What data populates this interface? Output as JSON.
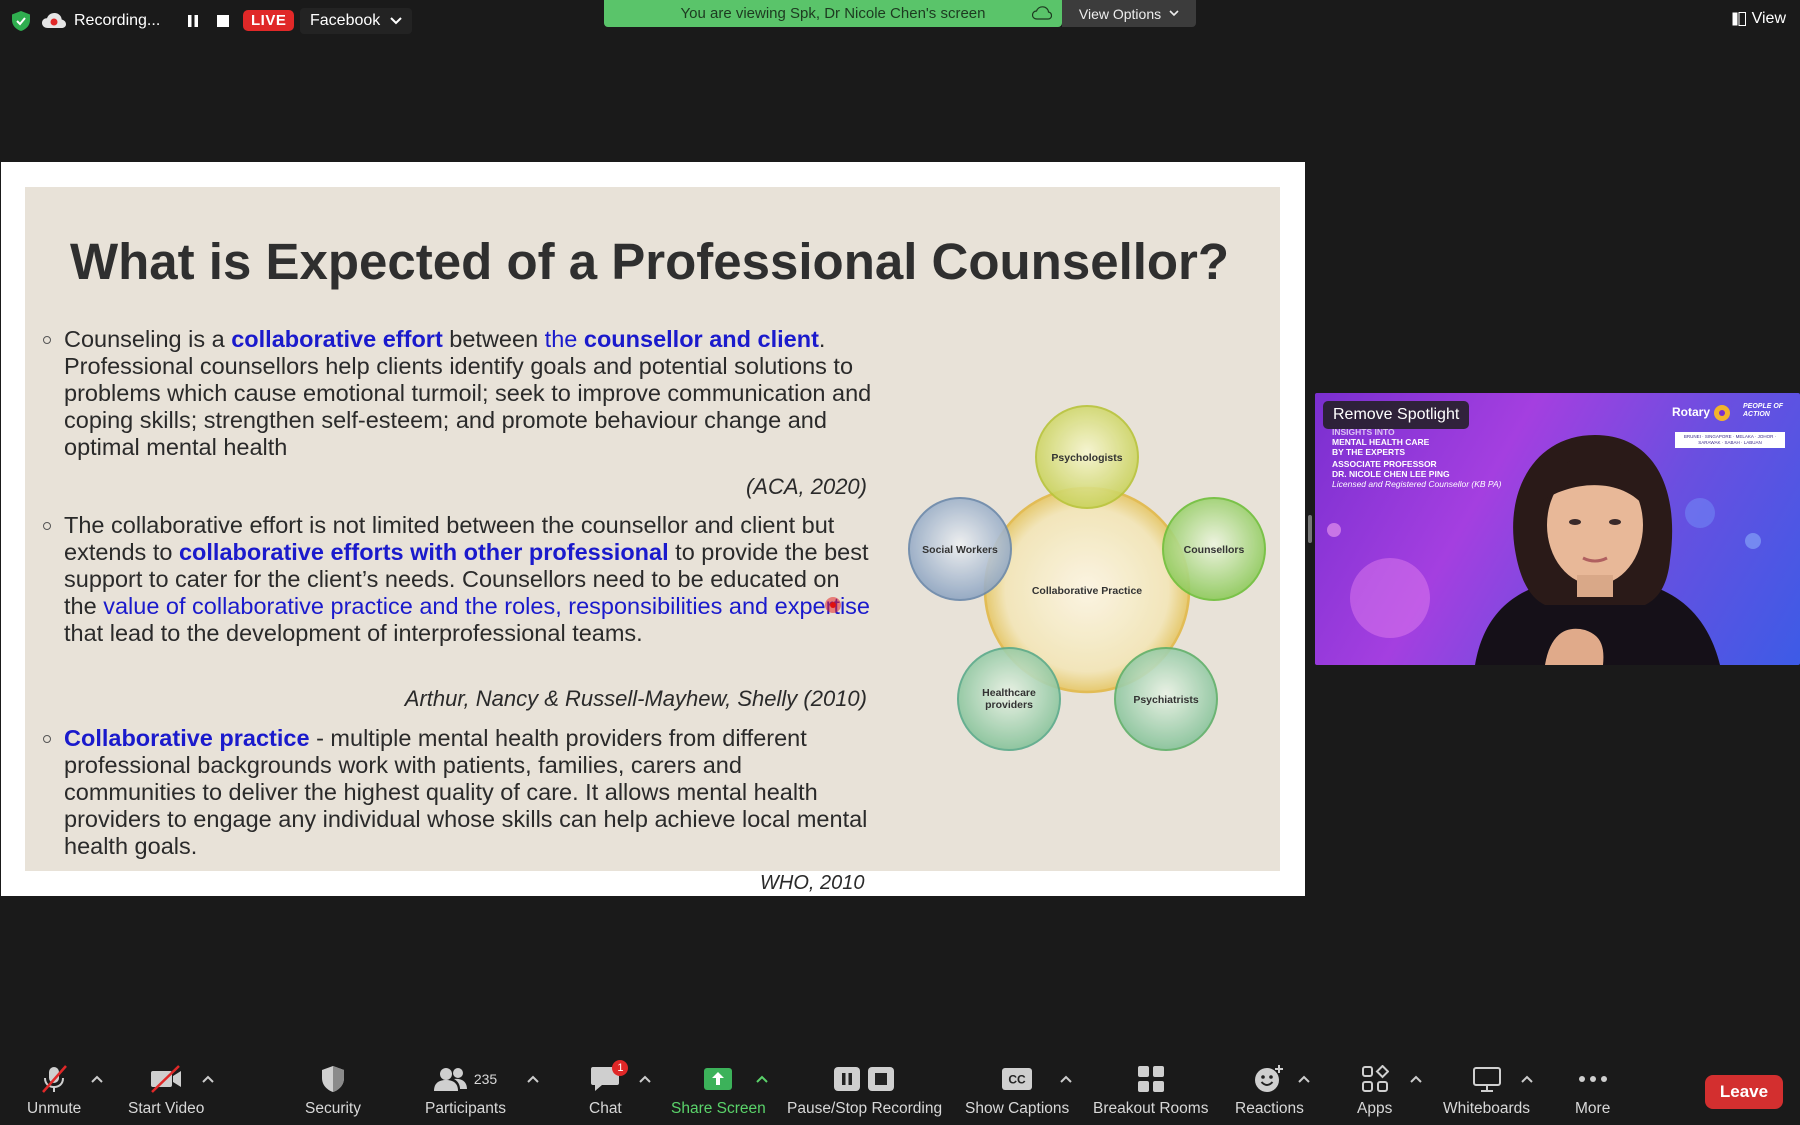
{
  "topbar": {
    "recording_label": "Recording...",
    "live_label": "LIVE",
    "stream_target": "Facebook",
    "viewing_banner": "You are viewing Spk, Dr Nicole Chen's screen",
    "view_options_label": "View Options",
    "view_label": "View"
  },
  "slide": {
    "title": "What is Expected of a Professional Counsellor?",
    "bullet1": {
      "t1": "Counseling is a ",
      "h1": "collaborative effort",
      "t2": " between ",
      "h2a": "the ",
      "h2b": "counsellor and client",
      "t3": ". Professional counsellors help clients identify goals and potential solutions to problems which cause emotional turmoil; seek to improve communication and coping skills; strengthen self-esteem; and promote behaviour change and optimal mental health"
    },
    "cite1": "(ACA, 2020)",
    "bullet2": {
      "t1": "The collaborative effort is not limited between the counsellor and client but extends to ",
      "h1": "collaborative efforts with other professional",
      "t2": " to provide the best support to cater for the client’s needs. Counsellors need to be educated on the ",
      "h2": "value of collaborative practice and the roles, responsibilities and expertise",
      "t3": " that lead to the development of interprofessional teams."
    },
    "cite2": "Arthur, Nancy & Russell-Mayhew, Shelly (2010)",
    "bullet3": {
      "h1": "Collaborative practice",
      "t1": "  - multiple mental health providers from different professional backgrounds work with patients, families, carers and communities to deliver the highest quality of care. It allows mental health providers to engage any individual whose skills can help achieve local mental health goals."
    },
    "cite3": "WHO, 2010",
    "diagram": {
      "center": "Collaborative Practice",
      "nodes": [
        "Psychologists",
        "Counsellors",
        "Psychiatrists",
        "Healthcare",
        "providers",
        "Social Workers"
      ]
    }
  },
  "video": {
    "remove_spotlight": "Remove Spotlight",
    "rotary": "Rotary",
    "people_of_action": [
      "PEOPLE OF",
      "ACTION"
    ],
    "locations": "BRUNEI · SINGAPORE · MELAKA · JOHOR · SARAWAK · SABAH · LABUAN",
    "lines": [
      "INSIGHTS INTO",
      "MENTAL HEALTH CARE",
      "BY THE EXPERTS",
      "ASSOCIATE PROFESSOR",
      "DR. NICOLE CHEN LEE PING"
    ],
    "sub": "Licensed and Registered Counsellor (KB PA)"
  },
  "toolbar": {
    "unmute": "Unmute",
    "start_video": "Start Video",
    "security": "Security",
    "participants": "Participants",
    "participant_count": "235",
    "chat": "Chat",
    "chat_badge": "1",
    "share_screen": "Share Screen",
    "pause_stop": "Pause/Stop Recording",
    "captions": "Show Captions",
    "cc": "CC",
    "breakout": "Breakout Rooms",
    "reactions": "Reactions",
    "apps": "Apps",
    "whiteboards": "Whiteboards",
    "more": "More",
    "leave": "Leave"
  },
  "colors": {
    "banner_green": "#5ac46a",
    "live_red": "#e02828",
    "leave_red": "#d32f2f",
    "highlight_blue": "#1a1acc"
  }
}
